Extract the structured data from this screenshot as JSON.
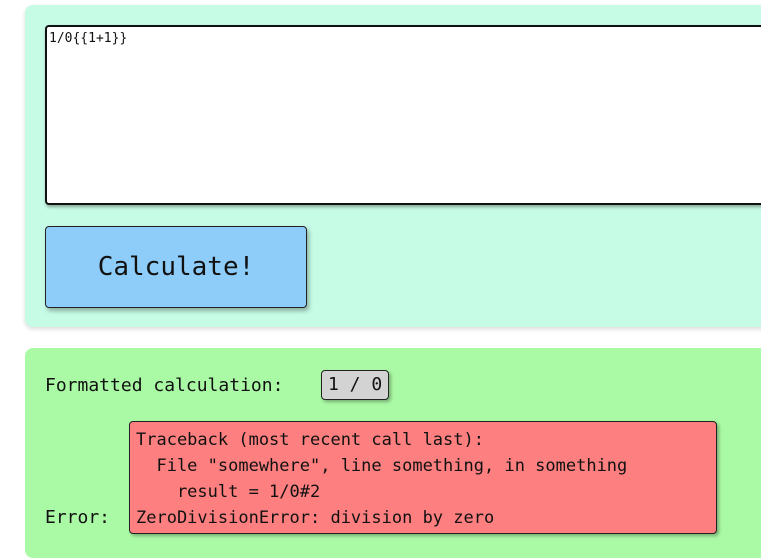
{
  "input": {
    "expression": "1/0{{1+1}}"
  },
  "button": {
    "label": "Calculate!"
  },
  "result": {
    "formatted_label": "Formatted calculation:",
    "formatted_value": "1 / 0",
    "error_label": "Error:",
    "traceback_lines": [
      "Traceback (most recent call last):",
      "  File \"somewhere\", line something, in something",
      "    result = 1/0#2",
      "ZeroDivisionError: division by zero"
    ]
  },
  "colors": {
    "input_panel_bg": "#c6fbe6",
    "result_panel_bg": "#aaf9a5",
    "button_bg": "#8ecdfa",
    "error_bg": "#fd7f7f",
    "formatted_bg": "#d3d3d3"
  }
}
